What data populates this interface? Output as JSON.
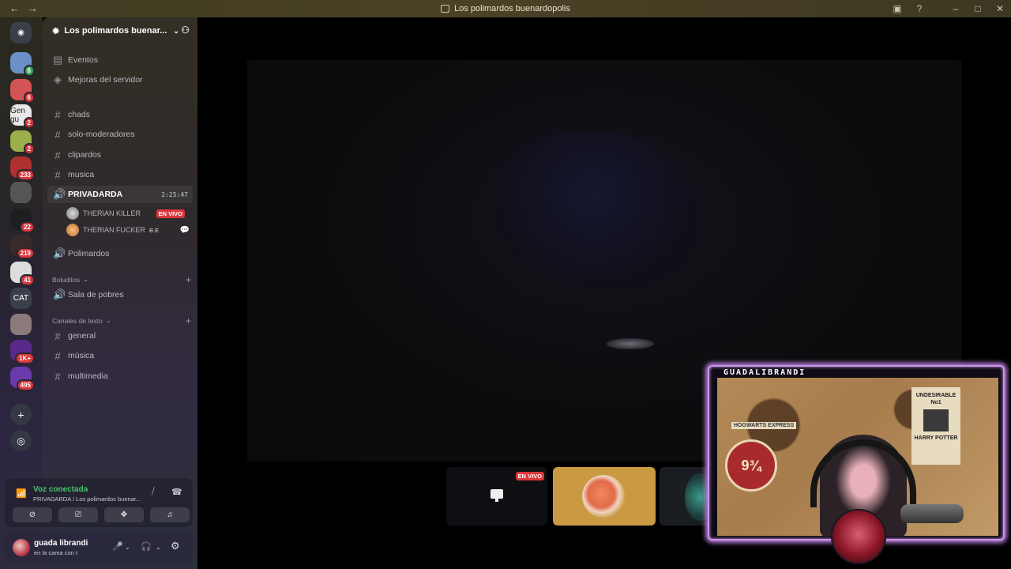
{
  "window": {
    "title": "Los polimardos buenardopolis"
  },
  "servers": [
    {
      "label": "",
      "badge": "6",
      "color": "#6b8fc7"
    },
    {
      "label": "",
      "badge": "6",
      "color": "#d35454"
    },
    {
      "label": "Gen gu",
      "badge": "2",
      "color": "#e8e8e8"
    },
    {
      "label": "",
      "badge": "2",
      "color": "#9bb04a"
    },
    {
      "label": "",
      "badge": "233",
      "color": "#b03030"
    },
    {
      "label": "",
      "badge": "",
      "color": "#555555"
    },
    {
      "label": "",
      "badge": "22",
      "color": "#1e1e1e"
    },
    {
      "label": "",
      "badge": "219",
      "color": "#3a2a2a"
    },
    {
      "label": "",
      "badge": "41",
      "color": "#dddddd"
    },
    {
      "label": "CAT",
      "badge": "",
      "color": "#3a3f4a"
    },
    {
      "label": "",
      "badge": "",
      "color": "#8a7a7a"
    },
    {
      "label": "",
      "badge": "1K+",
      "color": "#5a2a8a"
    },
    {
      "label": "",
      "badge": "495",
      "color": "#6a3aaa"
    }
  ],
  "server": {
    "name": "Los polimardos buenar..."
  },
  "top_items": [
    {
      "label": "Eventos",
      "icon": "calendar-icon"
    },
    {
      "label": "Mejoras del servidor",
      "icon": "boost-icon"
    }
  ],
  "channels": {
    "chads": "chads",
    "solo_moderadores": "solo-moderadores",
    "clipardos": "clipardos",
    "musica": "musica",
    "privadarda": "PRIVADARDA",
    "privadarda_time": "2:25:47",
    "polimardos": "Polimardos"
  },
  "voice_users": [
    {
      "name": "THERIAN KILLER",
      "tag": "EN VIVO"
    },
    {
      "name": "THERIAN FUCKER",
      "tag": "B.E"
    }
  ],
  "cat1": {
    "label": "Boluditos",
    "channel": "Sala de pobres"
  },
  "cat2": {
    "label": "Canales de texto",
    "channels": [
      "general",
      "música",
      "multimedia"
    ]
  },
  "voice_panel": {
    "status": "Voz conectada",
    "channel": "PRIVADARDA / Los polimardos buenar..."
  },
  "user": {
    "name": "guada librandi",
    "status": "en la cama con t"
  },
  "stream": {
    "live": "EN VIVO"
  },
  "cam": {
    "name": "GUADALIBRANDI",
    "sign": "9¾",
    "poster": [
      "UNDESIRABLE",
      "No1",
      "HARRY POTTER"
    ],
    "hogwarts": "HOGWARTS EXPRESS"
  }
}
